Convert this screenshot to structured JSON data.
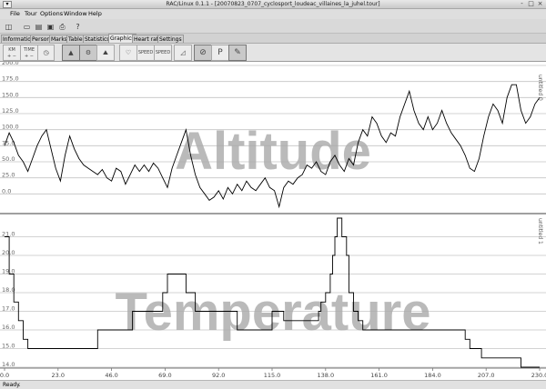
{
  "window": {
    "menu_glyph": "▾",
    "title": "RAC/Linux 0.1.1 - [20070823_0707_cyclosport_loudeac_villaines_la_juhel.tour]",
    "btn_min": "-",
    "btn_max": "□",
    "btn_close": "×"
  },
  "menu": [
    "File",
    "Tour",
    "Options",
    "Window",
    "Help"
  ],
  "toolbar": {
    "new_glyph": "◫",
    "doc_glyph": "▭",
    "open_glyph": "▤",
    "save_glyph": "▣",
    "print_glyph": "⎙",
    "help_glyph": "?"
  },
  "tabs": [
    "Information",
    "Person",
    "Marks",
    "Table",
    "Statistics",
    "Graphics",
    "Heart rate",
    "Settings"
  ],
  "active_tab": "Graphics",
  "graph_toolbar": {
    "km_top": "KM",
    "km_bottom": "+ −",
    "time_top": "TIME",
    "time_bottom": "+ −",
    "clock_glyph": "◷",
    "altitude_glyph": "▲",
    "bike_glyph": "⚙",
    "climb_glyph": "⛰",
    "heart_glyph": "♡",
    "speed_label": "SPEED",
    "speed2_label": "SPEED",
    "slope_glyph": "◿",
    "compass_glyph": "⊘",
    "pause_label": "P",
    "pen_glyph": "✎"
  },
  "status": "Ready.",
  "colors": {
    "grid": "#c4c4c4",
    "line": "#000000",
    "watermark": "#a9a9a9",
    "panel_sep": "#808080"
  },
  "chart_data": [
    {
      "type": "line",
      "title": "Altitude",
      "series_label": "untitled 0",
      "yticks": [
        "0.0",
        "25.0",
        "50.0",
        "75.0",
        "100.0",
        "125.0",
        "150.0",
        "175.0",
        "200.0"
      ],
      "ylim": [
        -25,
        200
      ],
      "xlim": [
        0,
        230
      ],
      "x": [
        0,
        2,
        4,
        6,
        8,
        10,
        12,
        14,
        16,
        18,
        20,
        22,
        24,
        26,
        28,
        30,
        32,
        34,
        36,
        38,
        40,
        42,
        44,
        46,
        48,
        50,
        52,
        54,
        56,
        58,
        60,
        62,
        64,
        66,
        68,
        70,
        72,
        74,
        76,
        78,
        80,
        82,
        84,
        86,
        88,
        90,
        92,
        94,
        96,
        98,
        100,
        102,
        104,
        106,
        108,
        110,
        112,
        114,
        116,
        118,
        120,
        122,
        124,
        126,
        128,
        130,
        132,
        134,
        136,
        138,
        140,
        142,
        144,
        146,
        148,
        150,
        152,
        154,
        156,
        158,
        160,
        162,
        164,
        166,
        168,
        170,
        172,
        174,
        176,
        178,
        180,
        182,
        184,
        186,
        188,
        190,
        192,
        194,
        196,
        198,
        200,
        202,
        204,
        206,
        208,
        210,
        212,
        214,
        216,
        218,
        220,
        222,
        224,
        226,
        228,
        230
      ],
      "y": [
        75,
        95,
        80,
        60,
        50,
        35,
        55,
        75,
        90,
        100,
        70,
        40,
        20,
        60,
        90,
        70,
        55,
        45,
        40,
        35,
        30,
        38,
        25,
        20,
        40,
        35,
        15,
        30,
        45,
        35,
        45,
        35,
        48,
        40,
        25,
        10,
        40,
        60,
        80,
        100,
        60,
        30,
        10,
        0,
        -10,
        -5,
        5,
        -8,
        10,
        0,
        15,
        5,
        20,
        10,
        5,
        15,
        25,
        10,
        5,
        -20,
        10,
        20,
        15,
        25,
        30,
        45,
        40,
        50,
        35,
        30,
        50,
        60,
        45,
        35,
        55,
        45,
        80,
        100,
        90,
        120,
        110,
        90,
        80,
        95,
        90,
        120,
        140,
        160,
        130,
        110,
        100,
        120,
        100,
        110,
        130,
        110,
        95,
        85,
        75,
        60,
        40,
        35,
        55,
        90,
        120,
        140,
        130,
        110,
        150,
        170,
        170,
        130,
        110,
        120,
        140,
        150,
        120,
        110,
        125,
        155
      ]
    },
    {
      "type": "line",
      "title": "Temperature",
      "series_label": "untitled 1",
      "yticks": [
        "14.0",
        "15.0",
        "16.0",
        "17.0",
        "18.0",
        "19.0",
        "20.0",
        "21.0"
      ],
      "ylim": [
        14,
        22
      ],
      "xlim": [
        0,
        230
      ],
      "xticks": [
        "0.0",
        "23.0",
        "46.0",
        "69.0",
        "92.0",
        "115.0",
        "138.0",
        "161.0",
        "184.0",
        "207.0",
        "230.0"
      ],
      "x": [
        0,
        2,
        4,
        6,
        8,
        10,
        38,
        40,
        50,
        55,
        66,
        68,
        70,
        76,
        78,
        82,
        85,
        100,
        110,
        115,
        120,
        128,
        135,
        136,
        138,
        140,
        141,
        142,
        143,
        144,
        145,
        147,
        148,
        150,
        152,
        154,
        156,
        160,
        175,
        196,
        198,
        200,
        202,
        205,
        210,
        220,
        222,
        230
      ],
      "y": [
        21,
        19,
        17.5,
        16.5,
        15.5,
        15,
        15,
        16,
        16,
        17,
        17,
        18,
        19,
        19,
        18,
        17,
        17,
        16,
        16,
        17,
        16.5,
        16.5,
        17,
        17.5,
        18,
        19,
        20,
        21,
        22,
        22,
        21,
        20,
        18,
        17,
        16.5,
        16,
        16,
        16,
        16,
        16,
        15.5,
        15,
        15,
        14.5,
        14.5,
        14.5,
        14,
        14
      ]
    }
  ]
}
